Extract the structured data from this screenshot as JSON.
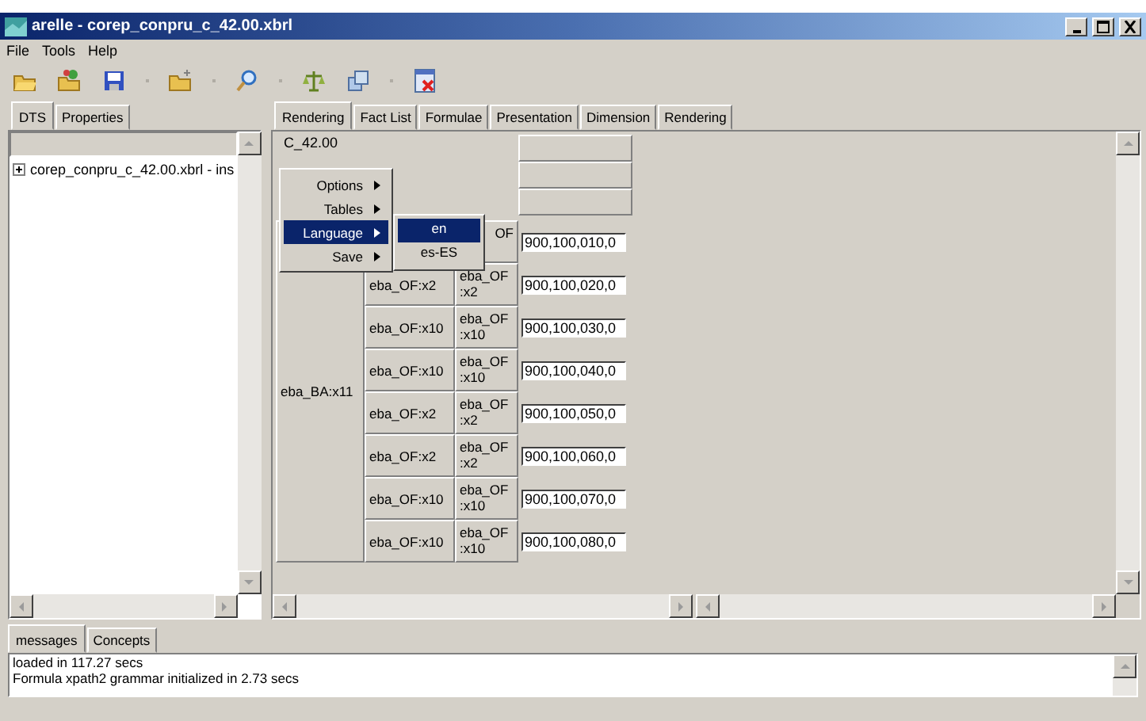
{
  "window": {
    "title": "arelle - corep_conpru_c_42.00.xbrl"
  },
  "menu": [
    "File",
    "Tools",
    "Help"
  ],
  "left_tabs": [
    {
      "label": "DTS",
      "selected": true
    },
    {
      "label": "Properties",
      "selected": false
    }
  ],
  "tree": [
    {
      "label": "corep_conpru_c_42.00.xbrl - ins",
      "expanded": false
    }
  ],
  "right_tabs": [
    {
      "label": "Rendering",
      "selected": true
    },
    {
      "label": "Fact List",
      "selected": false
    },
    {
      "label": "Formulae",
      "selected": false
    },
    {
      "label": "Presentation",
      "selected": false
    },
    {
      "label": "Dimension",
      "selected": false
    },
    {
      "label": "Rendering",
      "selected": false
    }
  ],
  "table": {
    "title": "C_42.00",
    "row_header": "eba_BA:x11",
    "rows": [
      {
        "member": "OF",
        "value": "900,100,010,0"
      },
      {
        "axis": "eba_OF:x2",
        "member": "eba_OF\n:x2",
        "value": "900,100,020,0"
      },
      {
        "axis": "eba_OF:x10",
        "member": "eba_OF\n:x10",
        "value": "900,100,030,0"
      },
      {
        "axis": "eba_OF:x10",
        "member": "eba_OF\n:x10",
        "value": "900,100,040,0"
      },
      {
        "axis": "eba_OF:x2",
        "member": "eba_OF\n:x2",
        "value": "900,100,050,0"
      },
      {
        "axis": "eba_OF:x2",
        "member": "eba_OF\n:x2",
        "value": "900,100,060,0"
      },
      {
        "axis": "eba_OF:x10",
        "member": "eba_OF\n:x10",
        "value": "900,100,070,0"
      },
      {
        "axis": "eba_OF:x10",
        "member": "eba_OF\n:x10",
        "value": "900,100,080,0"
      }
    ]
  },
  "context_menu": {
    "items": [
      {
        "label": "Options",
        "selected": false
      },
      {
        "label": "Tables",
        "selected": false
      },
      {
        "label": "Language",
        "selected": true
      },
      {
        "label": "Save",
        "selected": false
      }
    ],
    "submenu": [
      {
        "label": "en",
        "selected": true
      },
      {
        "label": "es-ES",
        "selected": false
      }
    ]
  },
  "bottom_tabs": [
    {
      "label": "messages",
      "selected": true
    },
    {
      "label": "Concepts",
      "selected": false
    }
  ],
  "messages": [
    "loaded in 117.27 secs",
    "Formula xpath2 grammar initialized in 2.73 secs"
  ]
}
